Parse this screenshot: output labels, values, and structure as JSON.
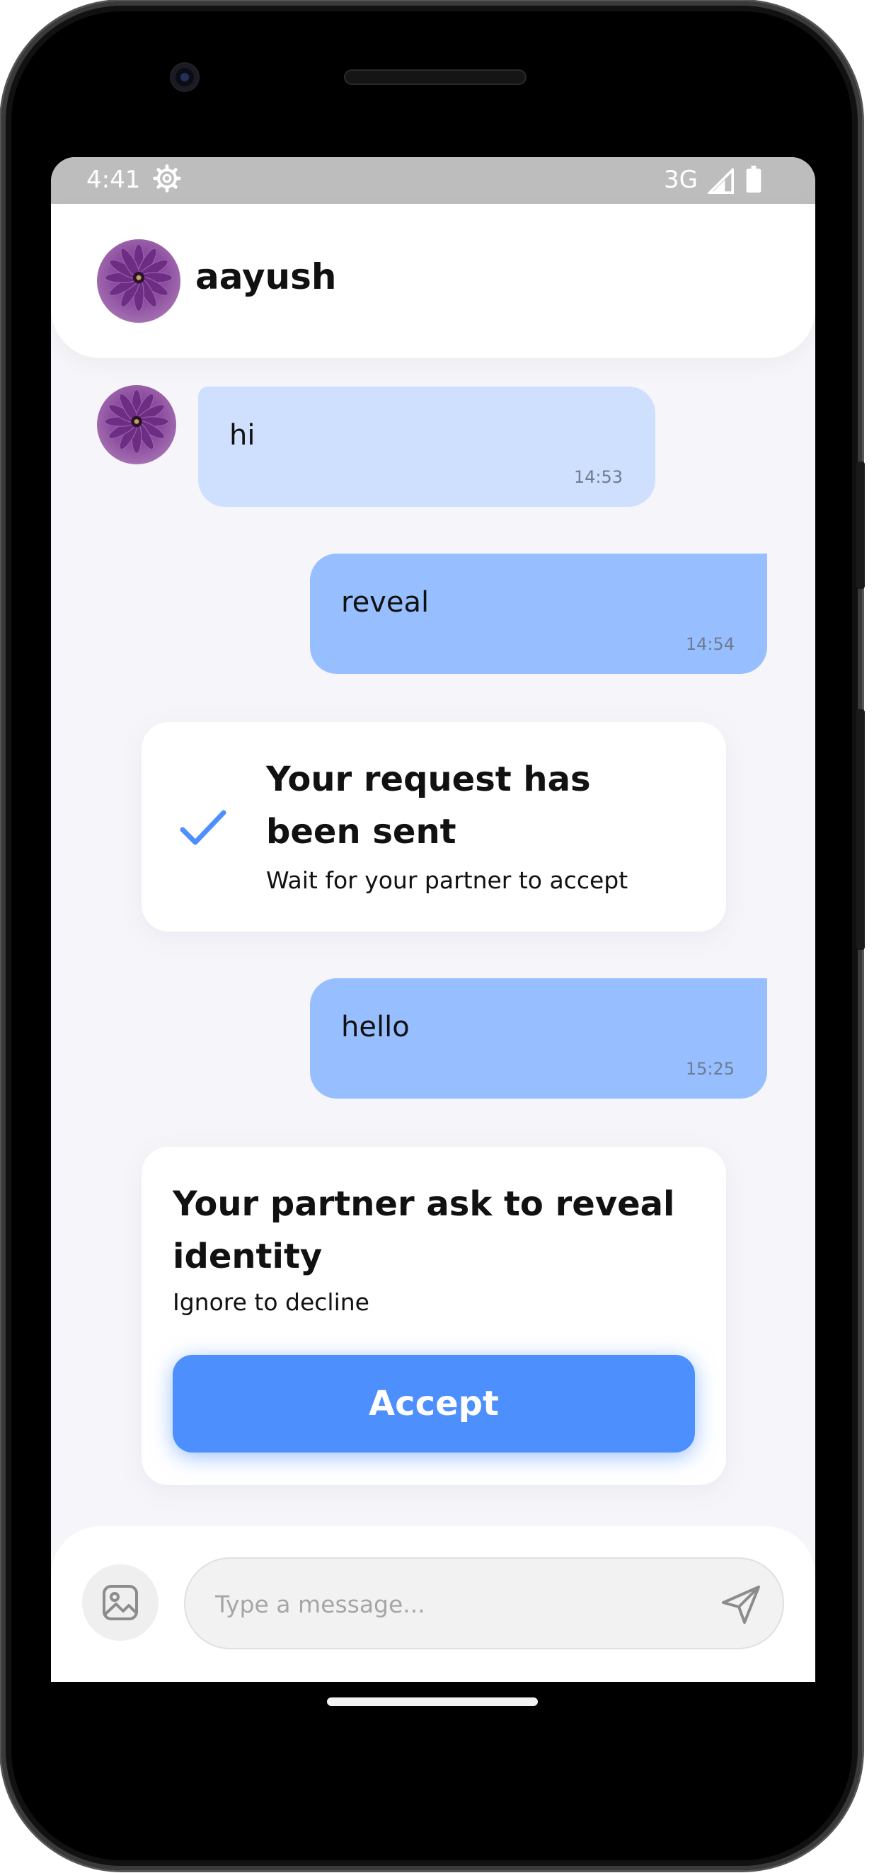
{
  "status_bar": {
    "time": "4:41",
    "network": "3G"
  },
  "chat": {
    "contact_name": "aayush"
  },
  "messages": [
    {
      "direction": "incoming",
      "text": "hi",
      "time": "14:53"
    },
    {
      "direction": "outgoing",
      "text": "reveal",
      "time": "14:54"
    },
    {
      "direction": "outgoing",
      "text": "hello",
      "time": "15:25"
    }
  ],
  "request_sent_card": {
    "title": "Your request has been sent",
    "subtitle": "Wait for your partner to accept"
  },
  "reveal_request_card": {
    "title": "Your partner ask to reveal identity",
    "subtitle": "Ignore to decline",
    "accept_label": "Accept"
  },
  "composer": {
    "placeholder": "Type a message...",
    "image_icon": "image-icon",
    "send_icon": "send-icon"
  },
  "colors": {
    "accent": "#4d8ffd",
    "incoming_bubble": "#cfe0ff",
    "outgoing_bubble": "#97bfff",
    "check": "#4d8ffd"
  }
}
